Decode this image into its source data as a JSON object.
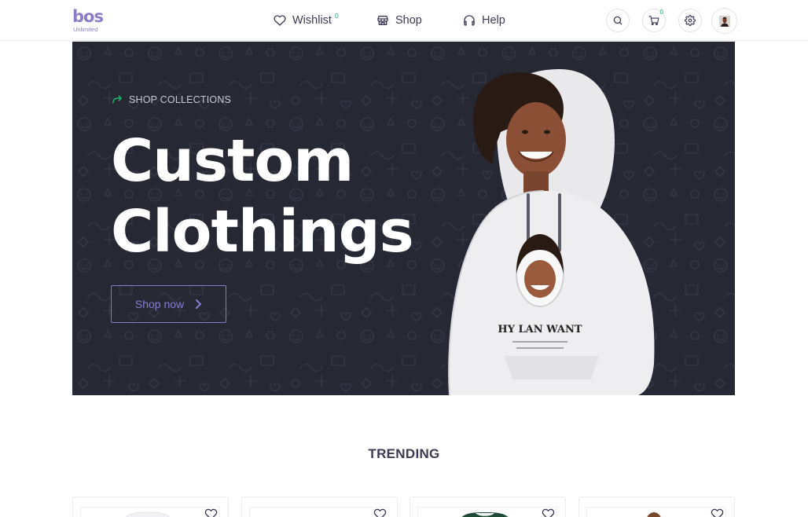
{
  "brand": {
    "name": "bos",
    "tagline": "Unlimited",
    "color": "#8a7cc6"
  },
  "nav": {
    "links": [
      {
        "label": "Wishlist",
        "icon": "heart-icon",
        "badge": "0"
      },
      {
        "label": "Shop",
        "icon": "store-icon"
      },
      {
        "label": "Help",
        "icon": "headphones-icon"
      }
    ],
    "cart_badge": "0",
    "icons": [
      "search-icon",
      "cart-icon",
      "gear-icon",
      "avatar"
    ]
  },
  "hero": {
    "eyebrow": "SHOP COLLECTIONS",
    "title_line1": "Custom",
    "title_line2": "Clothings",
    "cta": "Shop now",
    "hoodie_print": "HY LAN WANT",
    "colors": {
      "background": "#262833",
      "accent": "#8677cf",
      "eyebrow_icon": "#1cb86a"
    }
  },
  "trending": {
    "heading": "TRENDING",
    "products": [
      {
        "icon": "heart-icon",
        "shirt_color": "#ffffff"
      },
      {
        "icon": "heart-icon",
        "shirt_color": "#ffffff"
      },
      {
        "icon": "heart-icon",
        "shirt_color": "#1f4a36"
      },
      {
        "icon": "heart-icon",
        "shirt_color": "#7a4a2c"
      }
    ]
  }
}
